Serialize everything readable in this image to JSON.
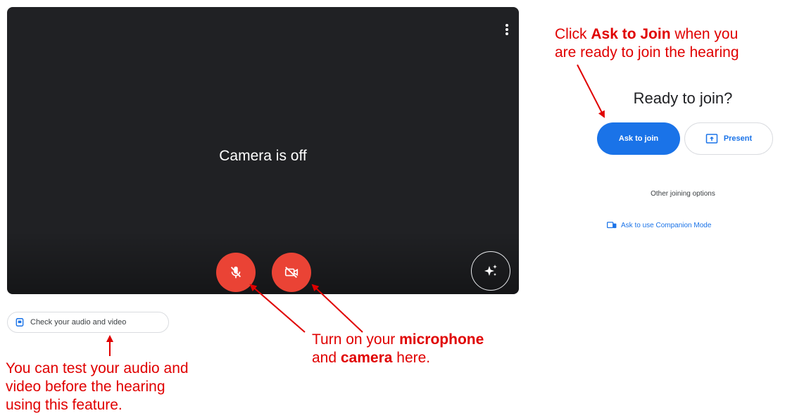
{
  "preview": {
    "camera_status": "Camera is off",
    "more_options_icon": "more-vert-icon",
    "mic_icon": "mic-off-icon",
    "camera_icon": "videocam-off-icon",
    "effects_icon": "sparkle-effects-icon",
    "mic_color": "#ea4335",
    "camera_color": "#ea4335"
  },
  "check_audio_video": {
    "label": "Check your audio and video",
    "icon": "audio-check-icon"
  },
  "join_panel": {
    "title": "Ready to join?",
    "ask_to_join_label": "Ask to join",
    "present_label": "Present",
    "present_icon": "present-screen-icon",
    "other_options_label": "Other joining options",
    "companion_mode_label": "Ask to use Companion Mode",
    "companion_icon": "companion-mode-icon",
    "accent_color": "#1a73e8"
  },
  "annotations": {
    "top_right": {
      "part1": "Click ",
      "bold1": "Ask to Join",
      "part2": " when you",
      "line2": "are ready to join the hearing"
    },
    "middle": {
      "part1": "Turn on your ",
      "bold1": "microphone",
      "line2_part0": "and ",
      "bold2": "camera",
      "line2_part1": " here."
    },
    "bottom_left": {
      "line1": "You can test your audio and",
      "line2": "video before the hearing",
      "line3": "using this feature."
    },
    "color": "#e00000"
  }
}
